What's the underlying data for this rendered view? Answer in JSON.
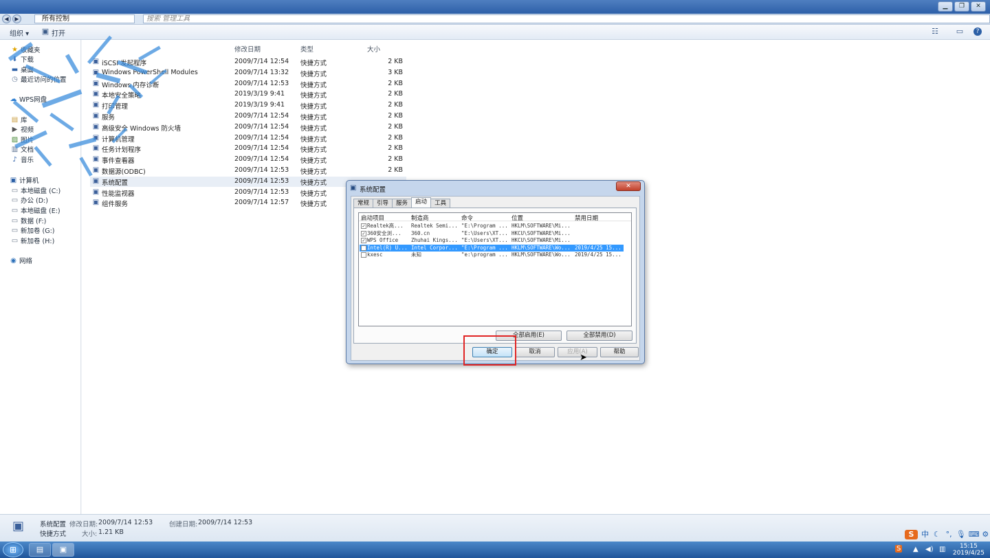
{
  "window": {
    "minimize": "▁",
    "restore": "❐",
    "close": "✕"
  },
  "address": {
    "path": "所有控制",
    "search_placeholder": "搜索 管理工具"
  },
  "toolbar": {
    "organize": "组织 ▾",
    "open": "打开"
  },
  "nav": {
    "favorites": [
      {
        "label": "收藏夹",
        "icon": "star-icon"
      },
      {
        "label": "下载",
        "icon": "download-folder-icon"
      },
      {
        "label": "桌面",
        "icon": "desktop-icon"
      },
      {
        "label": "最近访问的位置",
        "icon": "recent-icon"
      }
    ],
    "wps": "WPS网盘",
    "libraries": [
      {
        "label": "库",
        "icon": "library-icon"
      },
      {
        "label": "视频",
        "icon": "video-icon"
      },
      {
        "label": "图片",
        "icon": "picture-icon"
      },
      {
        "label": "文档",
        "icon": "document-icon"
      },
      {
        "label": "音乐",
        "icon": "music-icon"
      }
    ],
    "computer": "计算机",
    "drives": [
      "本地磁盘 (C:)",
      "办公 (D:)",
      "本地磁盘 (E:)",
      "数据 (F:)",
      "新加卷 (G:)",
      "新加卷 (H:)"
    ],
    "network": "网络"
  },
  "columns": {
    "date": "修改日期",
    "type": "类型",
    "size": "大小"
  },
  "files": [
    {
      "name": "iSCSI 发起程序",
      "date": "2009/7/14 12:54",
      "type": "快捷方式",
      "size": "2 KB"
    },
    {
      "name": "Windows PowerShell Modules",
      "date": "2009/7/14 13:32",
      "type": "快捷方式",
      "size": "3 KB"
    },
    {
      "name": "Windows 内存诊断",
      "date": "2009/7/14 12:53",
      "type": "快捷方式",
      "size": "2 KB"
    },
    {
      "name": "本地安全策略",
      "date": "2019/3/19 9:41",
      "type": "快捷方式",
      "size": "2 KB"
    },
    {
      "name": "打印管理",
      "date": "2019/3/19 9:41",
      "type": "快捷方式",
      "size": "2 KB"
    },
    {
      "name": "服务",
      "date": "2009/7/14 12:54",
      "type": "快捷方式",
      "size": "2 KB"
    },
    {
      "name": "高级安全 Windows 防火墙",
      "date": "2009/7/14 12:54",
      "type": "快捷方式",
      "size": "2 KB"
    },
    {
      "name": "计算机管理",
      "date": "2009/7/14 12:54",
      "type": "快捷方式",
      "size": "2 KB"
    },
    {
      "name": "任务计划程序",
      "date": "2009/7/14 12:54",
      "type": "快捷方式",
      "size": "2 KB"
    },
    {
      "name": "事件查看器",
      "date": "2009/7/14 12:54",
      "type": "快捷方式",
      "size": "2 KB"
    },
    {
      "name": "数据源(ODBC)",
      "date": "2009/7/14 12:53",
      "type": "快捷方式",
      "size": "2 KB"
    },
    {
      "name": "系统配置",
      "date": "2009/7/14 12:53",
      "type": "快捷方式",
      "size": ""
    },
    {
      "name": "性能监视器",
      "date": "2009/7/14 12:53",
      "type": "快捷方式",
      "size": ""
    },
    {
      "name": "组件服务",
      "date": "2009/7/14 12:57",
      "type": "快捷方式",
      "size": ""
    }
  ],
  "details": {
    "name": "系统配置",
    "modified_label": "修改日期:",
    "modified": "2009/7/14 12:53",
    "created_label": "创建日期:",
    "created": "2009/7/14 12:53",
    "type": "快捷方式",
    "size_label": "大小:",
    "size": "1.21 KB"
  },
  "dialog": {
    "title": "系统配置",
    "close": "✕",
    "tabs": [
      "常规",
      "引导",
      "服务",
      "启动",
      "工具"
    ],
    "active_tab": "启动",
    "list_headers": [
      "启动项目",
      "制造商",
      "命令",
      "位置",
      "禁用日期"
    ],
    "rows": [
      {
        "checked": true,
        "item": "Realtek高...",
        "maker": "Realtek Semi...",
        "cmd": "\"E:\\Program ...",
        "loc": "HKLM\\SOFTWARE\\Mi...",
        "date": ""
      },
      {
        "checked": true,
        "item": "360安全浏...",
        "maker": "360.cn",
        "cmd": "\"E:\\Users\\XT...",
        "loc": "HKCU\\SOFTWARE\\Mi...",
        "date": ""
      },
      {
        "checked": true,
        "item": "WPS Office",
        "maker": "Zhuhai Kings...",
        "cmd": "\"E:\\Users\\XT...",
        "loc": "HKCU\\SOFTWARE\\Mi...",
        "date": ""
      },
      {
        "checked": false,
        "item": "Intel(R) U...",
        "maker": "Intel Corpor...",
        "cmd": "\"E:\\Program ...",
        "loc": "HKLM\\SOFTWARE\\Wo...",
        "date": "2019/4/25 15..."
      },
      {
        "checked": false,
        "item": "kxesc",
        "maker": "未知",
        "cmd": "\"e:\\program ...",
        "loc": "HKLM\\SOFTWARE\\Wo...",
        "date": "2019/4/25 15..."
      }
    ],
    "enable_all": "全部启用(E)",
    "disable_all": "全部禁用(D)",
    "ok": "确定",
    "cancel": "取消",
    "apply": "应用(A)",
    "help": "帮助"
  },
  "ime": {
    "logo": "S",
    "lang": "中"
  },
  "clock": {
    "time": "15:15",
    "date": "2019/4/25"
  },
  "colors": {
    "accent": "#3399ff",
    "highlight": "#e02424",
    "taskbar": "#20559a"
  }
}
